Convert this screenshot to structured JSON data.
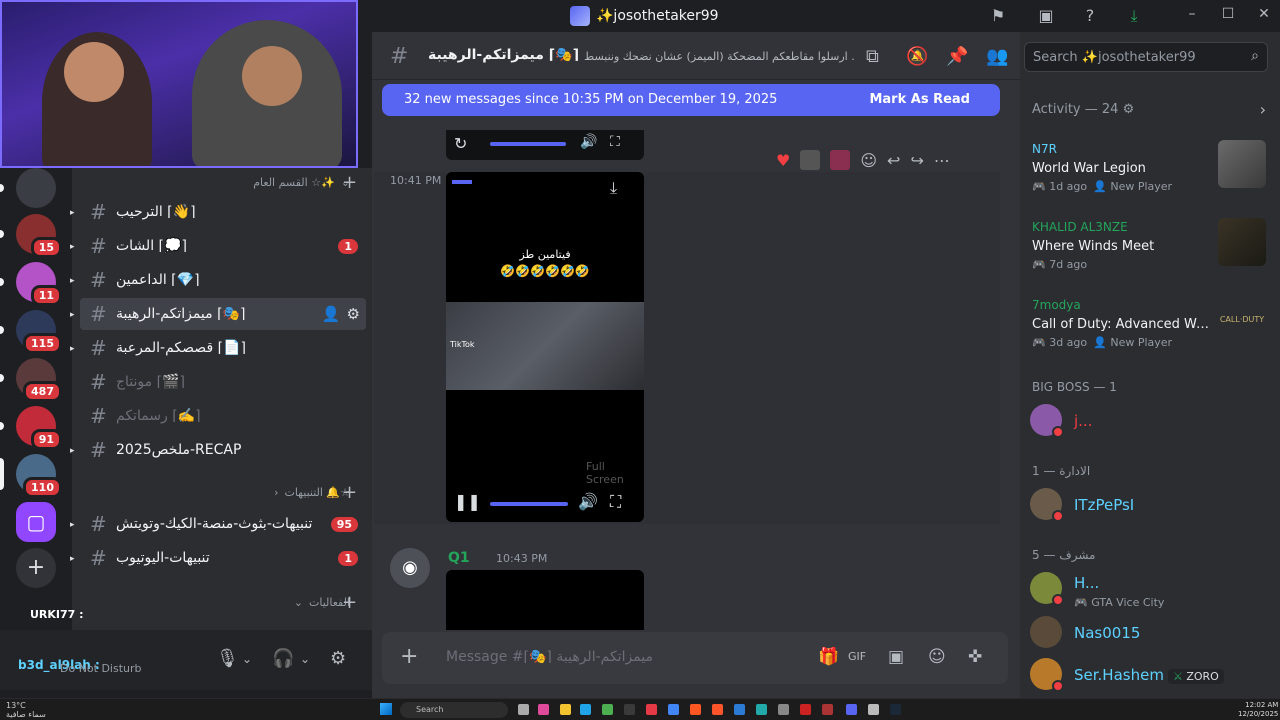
{
  "window": {
    "title": "✨josothetaker99"
  },
  "sidebar": {
    "categories": [
      {
        "label": "القسم العام ☆✨"
      },
      {
        "label": "التنبيهات 🔔☆"
      },
      {
        "label": "الفعاليات"
      }
    ],
    "channels": [
      {
        "name": "الترحيب ⌈👋⌉",
        "badge": ""
      },
      {
        "name": "الشات ⌈💭⌉",
        "badge": "1"
      },
      {
        "name": "الداعمين ⌈💎⌉",
        "badge": ""
      },
      {
        "name": "ميمزاتكم-الرهيبة ⌈🎭⌉",
        "badge": ""
      },
      {
        "name": "قصصكم-المرعبة ⌈📄⌉",
        "badge": ""
      },
      {
        "name": "مونتاج ⌈🎬⌉",
        "badge": ""
      },
      {
        "name": "رسماتكم ⌈✍️⌉",
        "badge": ""
      },
      {
        "name": "ملخص2025-RECAP",
        "badge": ""
      },
      {
        "name": "تنبيهات-بثوث-منصة-الكيك-وتويتش",
        "badge": "95"
      },
      {
        "name": "تنبيهات-اليوتيوب",
        "badge": "1"
      }
    ]
  },
  "rail": {
    "badges": [
      "15",
      "11",
      "115",
      "487",
      "91",
      "110"
    ]
  },
  "userpanel": {
    "overlay_name": "URKI77 :",
    "name": "b3d_al9lah :",
    "status": "Do Not Disturb"
  },
  "chat": {
    "channel_name": "ميمزاتكم-الرهيبة ⌈🎭⌉",
    "topic": "ارسلوا مقاطعكم المضحكة (الميمز) عشان نضحك وننبسط ...",
    "new_messages": "32 new messages since 10:35 PM on December 19, 2025",
    "mark_as_read": "Mark As Read",
    "timestamp": "10:41 PM",
    "video": {
      "caption": "فيتامين طز",
      "emoji": "🤣🤣🤣🤣🤣🤣",
      "tiktok": "TikTok",
      "fullscreen": "Full Screen"
    },
    "q1": {
      "name": "Q1",
      "time": "10:43 PM"
    },
    "composer_placeholder": "Message #⌈🎭⌉ ميمزاتكم-الرهيبة"
  },
  "right": {
    "search_placeholder": "Search ✨josothetaker99",
    "activity_header": "Activity — 24",
    "activities": [
      {
        "user": "N7R",
        "game": "World War Legion",
        "time": "1d ago",
        "tag": "New Player"
      },
      {
        "user": "KHALID AL3NZE",
        "game": "Where Winds Meet",
        "time": "7d ago",
        "tag": ""
      },
      {
        "user": "7modya",
        "game": "Call of Duty: Advanced Wa...",
        "time": "3d ago",
        "tag": "New Player"
      }
    ],
    "roles": [
      {
        "header": "BIG BOSS — 1"
      },
      {
        "header": "الادارة — 1"
      },
      {
        "header": "مشرف — 5"
      }
    ],
    "members": [
      {
        "name": "j...",
        "sub": "",
        "tag": "",
        "color": "#f23f43"
      },
      {
        "name": "ITzPePsI",
        "sub": "",
        "tag": "",
        "color": "#5ed1ff"
      },
      {
        "name": "H...",
        "sub": "GTA Vice City",
        "tag": "",
        "color": "#5ed1ff"
      },
      {
        "name": "Nas0015",
        "sub": "",
        "tag": "",
        "color": "#5ed1ff"
      },
      {
        "name": "Ser.Hashem",
        "sub": "",
        "tag": "ZORO",
        "color": "#5ed1ff"
      }
    ]
  },
  "taskbar": {
    "weather_temp": "13°C",
    "weather_desc": "سماء صافية",
    "search": "Search",
    "time": "12:02 AM",
    "date": "12/20/2025"
  },
  "colors": {
    "accent": "#5865f2",
    "danger": "#da373c",
    "online": "#23a55a"
  }
}
